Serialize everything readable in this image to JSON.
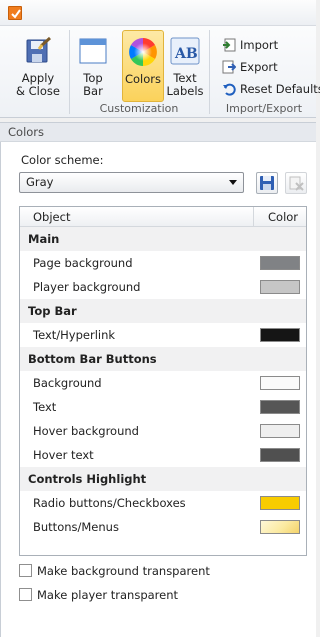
{
  "ribbon": {
    "apply_close": "Apply\n& Close",
    "top_bar": "Top\nBar",
    "colors": "Colors",
    "text_labels": "Text\nLabels",
    "group_customization": "Customization",
    "import": "Import",
    "export": "Export",
    "reset_defaults": "Reset Defaults",
    "group_import_export": "Import/Export"
  },
  "panel": {
    "title": "Colors",
    "scheme_label": "Color scheme:",
    "scheme_value": "Gray"
  },
  "table": {
    "col_object": "Object",
    "col_color": "Color",
    "rows": [
      {
        "type": "section",
        "label": "Main"
      },
      {
        "type": "item",
        "label": "Page background",
        "color": "#808285"
      },
      {
        "type": "item",
        "label": "Player background",
        "color": "#c6c6c6"
      },
      {
        "type": "section",
        "label": "Top Bar"
      },
      {
        "type": "item",
        "label": "Text/Hyperlink",
        "color": "#151515"
      },
      {
        "type": "section",
        "label": "Bottom Bar Buttons"
      },
      {
        "type": "item",
        "label": "Background",
        "color": "#fafafa"
      },
      {
        "type": "item",
        "label": "Text",
        "color": "#565656"
      },
      {
        "type": "item",
        "label": "Hover background",
        "color": "#efefef"
      },
      {
        "type": "item",
        "label": "Hover text",
        "color": "#505050"
      },
      {
        "type": "section",
        "label": "Controls Highlight"
      },
      {
        "type": "item",
        "label": "Radio buttons/Checkboxes",
        "color": "#f8cc00"
      },
      {
        "type": "item",
        "label": "Buttons/Menus",
        "color": "#fbeaa2"
      }
    ]
  },
  "options": {
    "bg_transparent": "Make background transparent",
    "player_transparent": "Make player transparent"
  },
  "colors": {
    "app_icon": "#f07d1e",
    "active_button": "#fbd25b"
  }
}
